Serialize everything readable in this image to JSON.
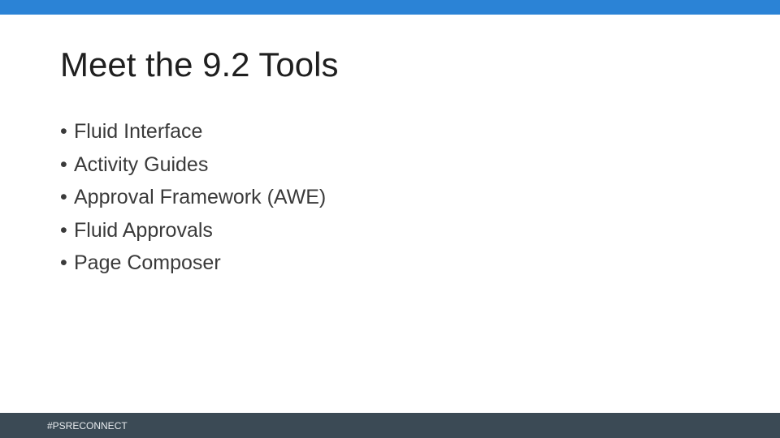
{
  "slide": {
    "title": "Meet the 9.2 Tools",
    "bullet_symbol": "•",
    "bullets": [
      "Fluid Interface",
      "Activity Guides",
      "Approval Framework (AWE)",
      "Fluid Approvals",
      "Page Composer"
    ],
    "footer": "#PSRECONNECT"
  },
  "colors": {
    "top_bar": "#2b83d6",
    "footer_bar": "#3b4a55",
    "title_text": "#1f1f1f",
    "body_text": "#3a3a3a",
    "footer_text": "#e8ecef"
  }
}
